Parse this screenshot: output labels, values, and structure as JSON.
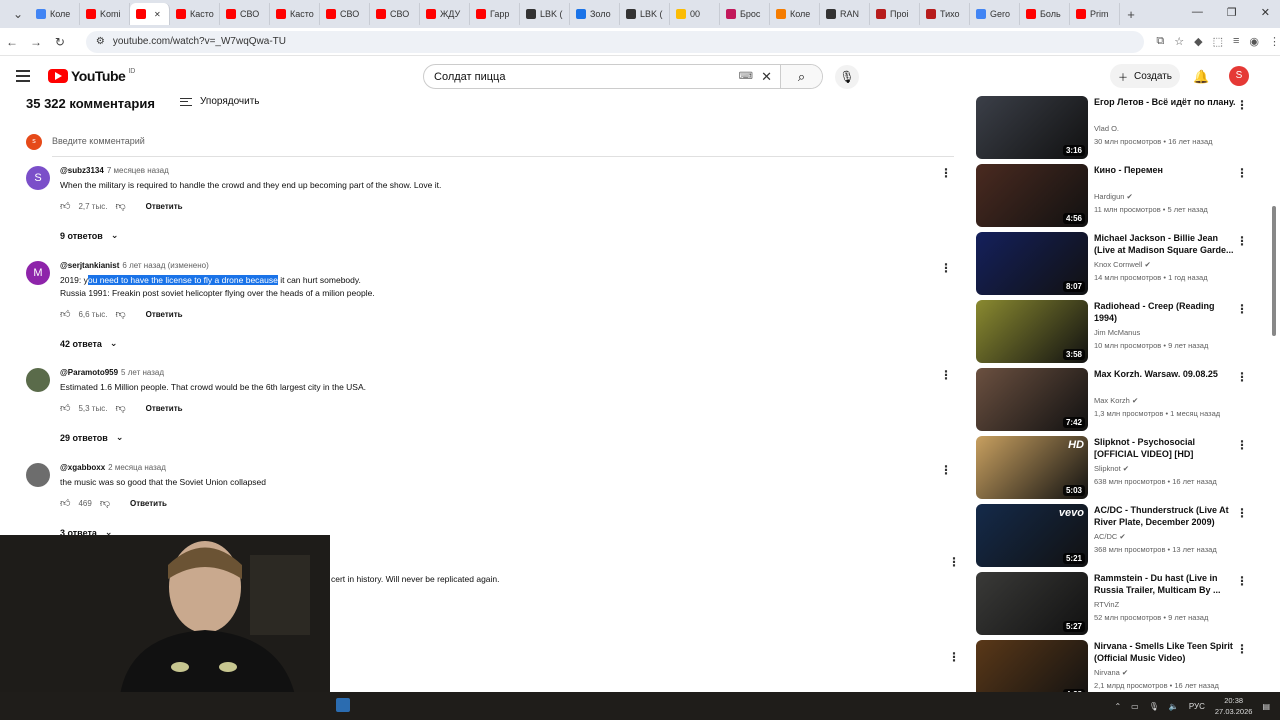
{
  "browser": {
    "tabs": [
      {
        "label": "Коле",
        "color": "#4285f4"
      },
      {
        "label": "Komi",
        "color": "#ff0000"
      },
      {
        "label": "",
        "color": "#ff0000",
        "active": true
      },
      {
        "label": "Касто",
        "color": "#ff0000"
      },
      {
        "label": "СВО",
        "color": "#ff0000"
      },
      {
        "label": "Касто",
        "color": "#ff0000"
      },
      {
        "label": "СВО",
        "color": "#ff0000"
      },
      {
        "label": "СВО",
        "color": "#ff0000"
      },
      {
        "label": "ЖДУ",
        "color": "#ff0000"
      },
      {
        "label": "Гарр",
        "color": "#ff0000"
      },
      {
        "label": "LBK (",
        "color": "#333333"
      },
      {
        "label": "Золо",
        "color": "#1a73e8"
      },
      {
        "label": "LBK (",
        "color": "#333333"
      },
      {
        "label": "00",
        "color": "#fbbc04"
      },
      {
        "label": "Брос",
        "color": "#c2185b"
      },
      {
        "label": "Коле",
        "color": "#f57c00"
      },
      {
        "label": "RAN",
        "color": "#333333"
      },
      {
        "label": "Проі",
        "color": "#b71c1c"
      },
      {
        "label": "Тихо",
        "color": "#b71c1c"
      },
      {
        "label": "Gero",
        "color": "#4285f4"
      },
      {
        "label": "Боль",
        "color": "#ff0000"
      },
      {
        "label": "Prim",
        "color": "#ff0000"
      }
    ],
    "url": "youtube.com/watch?v=_W7wqQwa-TU"
  },
  "header": {
    "logo_text": "YouTube",
    "logo_country": "ID",
    "search_value": "Солдат пицца",
    "create_label": "Создать",
    "avatar_letter": "S"
  },
  "comments_section": {
    "count_label": "35 322 комментария",
    "sort_label": "Упорядочить",
    "add_placeholder": "Введите комментарий",
    "add_avatar_letter": "s",
    "comments": [
      {
        "author": "@subz3134",
        "time": "7 месяцев назад",
        "line1": "When the military is required to handle the crowd and they end up becoming part of the show. Love it.",
        "likes": "2,7 тыс.",
        "reply_label": "Ответить",
        "replies_label": "9 ответов",
        "avatar_letter": "S",
        "avatar_color": "#7b4fc9"
      },
      {
        "author": "@serjtankianist",
        "time": "6 лет назад (изменено)",
        "line1_before": "2019: y",
        "line1_highlight": "ou need to have the license to fly a drone because",
        "line1_after": " it can hurt somebody.",
        "line2": "Russia 1991: Freakin post soviet helicopter flying over the heads of a milion people.",
        "likes": "6,6 тыс.",
        "reply_label": "Ответить",
        "replies_label": "42 ответа",
        "avatar_letter": "M",
        "avatar_color": "#8e24aa"
      },
      {
        "author": "@Paramoto959",
        "time": "5 лет назад",
        "line1": "Estimated 1.6 Million people. That crowd would be the 6th largest city in the USA.",
        "likes": "5,3 тыс.",
        "reply_label": "Ответить",
        "replies_label": "29 ответов",
        "avatar_letter": "",
        "avatar_color": "#5a6b4a"
      },
      {
        "author": "@xgabboxx",
        "time": "2 месяца назад",
        "line1": "the music was so good that the Soviet Union collapsed",
        "likes": "469",
        "reply_label": "Ответить",
        "replies_label": "3 ответа",
        "avatar_letter": "",
        "avatar_color": "#6d6d6d"
      }
    ],
    "partial_text": "cert in history.  Will never be replicated again."
  },
  "related_videos": [
    {
      "title": "Егор Летов - Всё идёт по плану.",
      "channel": "Vlad O.",
      "views": "30 млн просмотров",
      "age": "16 лет назад",
      "duration": "3:16",
      "verified": false,
      "thumb_color": "#3b3f48"
    },
    {
      "title": "Кино - Перемен",
      "channel": "Hardigun",
      "views": "11 млн просмотров",
      "age": "5 лет назад",
      "duration": "4:56",
      "verified": true,
      "thumb_color": "#4a2a20"
    },
    {
      "title": "Michael Jackson - Billie Jean (Live at Madison Square Garde...",
      "channel": "Knox Cornwell",
      "views": "14 млн просмотров",
      "age": "1 год назад",
      "duration": "8:07",
      "verified": true,
      "thumb_color": "#14205c"
    },
    {
      "title": "Radiohead - Creep (Reading 1994)",
      "channel": "Jim McManus",
      "views": "10 млн просмотров",
      "age": "9 лет назад",
      "duration": "3:58",
      "verified": false,
      "thumb_color": "#8a8a30"
    },
    {
      "title": "Max Korzh. Warsaw. 09.08.25",
      "channel": "Max Korzh",
      "views": "1,3 млн просмотров",
      "age": "1 месяц назад",
      "duration": "7:42",
      "verified": true,
      "thumb_color": "#6b5040"
    },
    {
      "title": "Slipknot - Psychosocial [OFFICIAL VIDEO] [HD]",
      "channel": "Slipknot",
      "views": "638 млн просмотров",
      "age": "16 лет назад",
      "duration": "5:03",
      "verified": true,
      "thumb_color": "#c8a060",
      "badge": "HD"
    },
    {
      "title": "AC/DC - Thunderstruck (Live At River Plate, December 2009)",
      "channel": "AC/DC",
      "views": "368 млн просмотров",
      "age": "13 лет назад",
      "duration": "5:21",
      "verified": true,
      "thumb_color": "#142a4a",
      "badge": "vevo"
    },
    {
      "title": "Rammstein - Du hast (Live in Russia Trailer, Multicam By ...",
      "channel": "RTVinZ",
      "views": "52 млн просмотров",
      "age": "9 лет назад",
      "duration": "5:27",
      "verified": false,
      "thumb_color": "#3a3a38"
    },
    {
      "title": "Nirvana - Smells Like Teen Spirit (Official Music Video)",
      "channel": "Nirvana",
      "views": "2,1 млрд просмотров",
      "age": "16 лет назад",
      "duration": "4:38",
      "verified": true,
      "thumb_color": "#5a3818"
    }
  ],
  "taskbar": {
    "lang": "РУС",
    "time": "20:38",
    "date": "27.03.2026"
  }
}
